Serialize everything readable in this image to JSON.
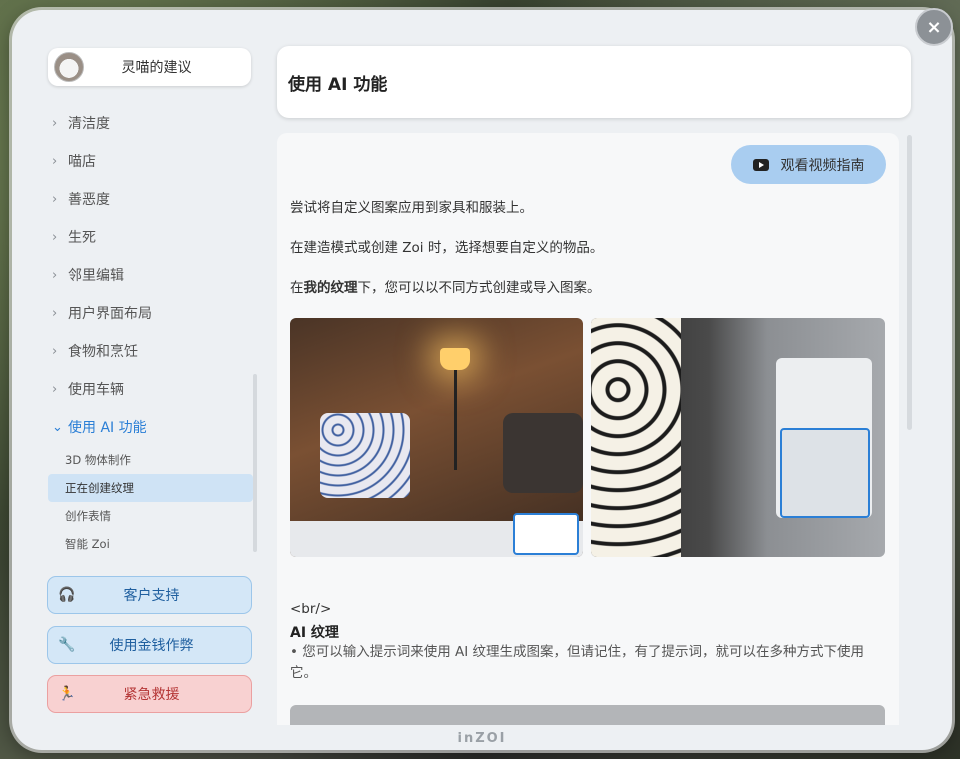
{
  "window": {
    "brand": "inZOI",
    "close_icon": "×"
  },
  "sidebar": {
    "advisor_label": "灵喵的建议",
    "items": [
      {
        "label": "清洁度"
      },
      {
        "label": "喵店"
      },
      {
        "label": "善恶度"
      },
      {
        "label": "生死"
      },
      {
        "label": "邻里编辑"
      },
      {
        "label": "用户界面布局"
      },
      {
        "label": "食物和烹饪"
      },
      {
        "label": "使用车辆"
      },
      {
        "label": "使用 AI 功能"
      }
    ],
    "sub_items": [
      {
        "label": "3D 物体制作"
      },
      {
        "label": "正在创建纹理"
      },
      {
        "label": "创作表情"
      },
      {
        "label": "智能 Zoi"
      }
    ],
    "actions": {
      "support": "客户支持",
      "cheat": "使用金钱作弊",
      "rescue": "紧急救援"
    }
  },
  "header": {
    "title": "使用 AI 功能"
  },
  "content": {
    "video_button": "观看视频指南",
    "paragraph1": "尝试将自定义图案应用到家具和服装上。",
    "paragraph2": "在建造模式或创建 Zoi 时，选择想要自定义的物品。",
    "paragraph3_pre": "在",
    "paragraph3_bold": "我的纹理",
    "paragraph3_post": "下，您可以以不同方式创建或导入图案。",
    "br_text": "<br/>",
    "section_title": "AI 纹理",
    "bullet": "• 您可以输入提示词来使用 AI 纹理生成图案，但请记住，有了提示词，就可以在多种方式下使用它。"
  },
  "colors": {
    "accent": "#2b7fd6",
    "support_bg": "#d4e7f7",
    "rescue_bg": "#f8d1d1",
    "video_btn_bg": "#a9cdf0"
  }
}
